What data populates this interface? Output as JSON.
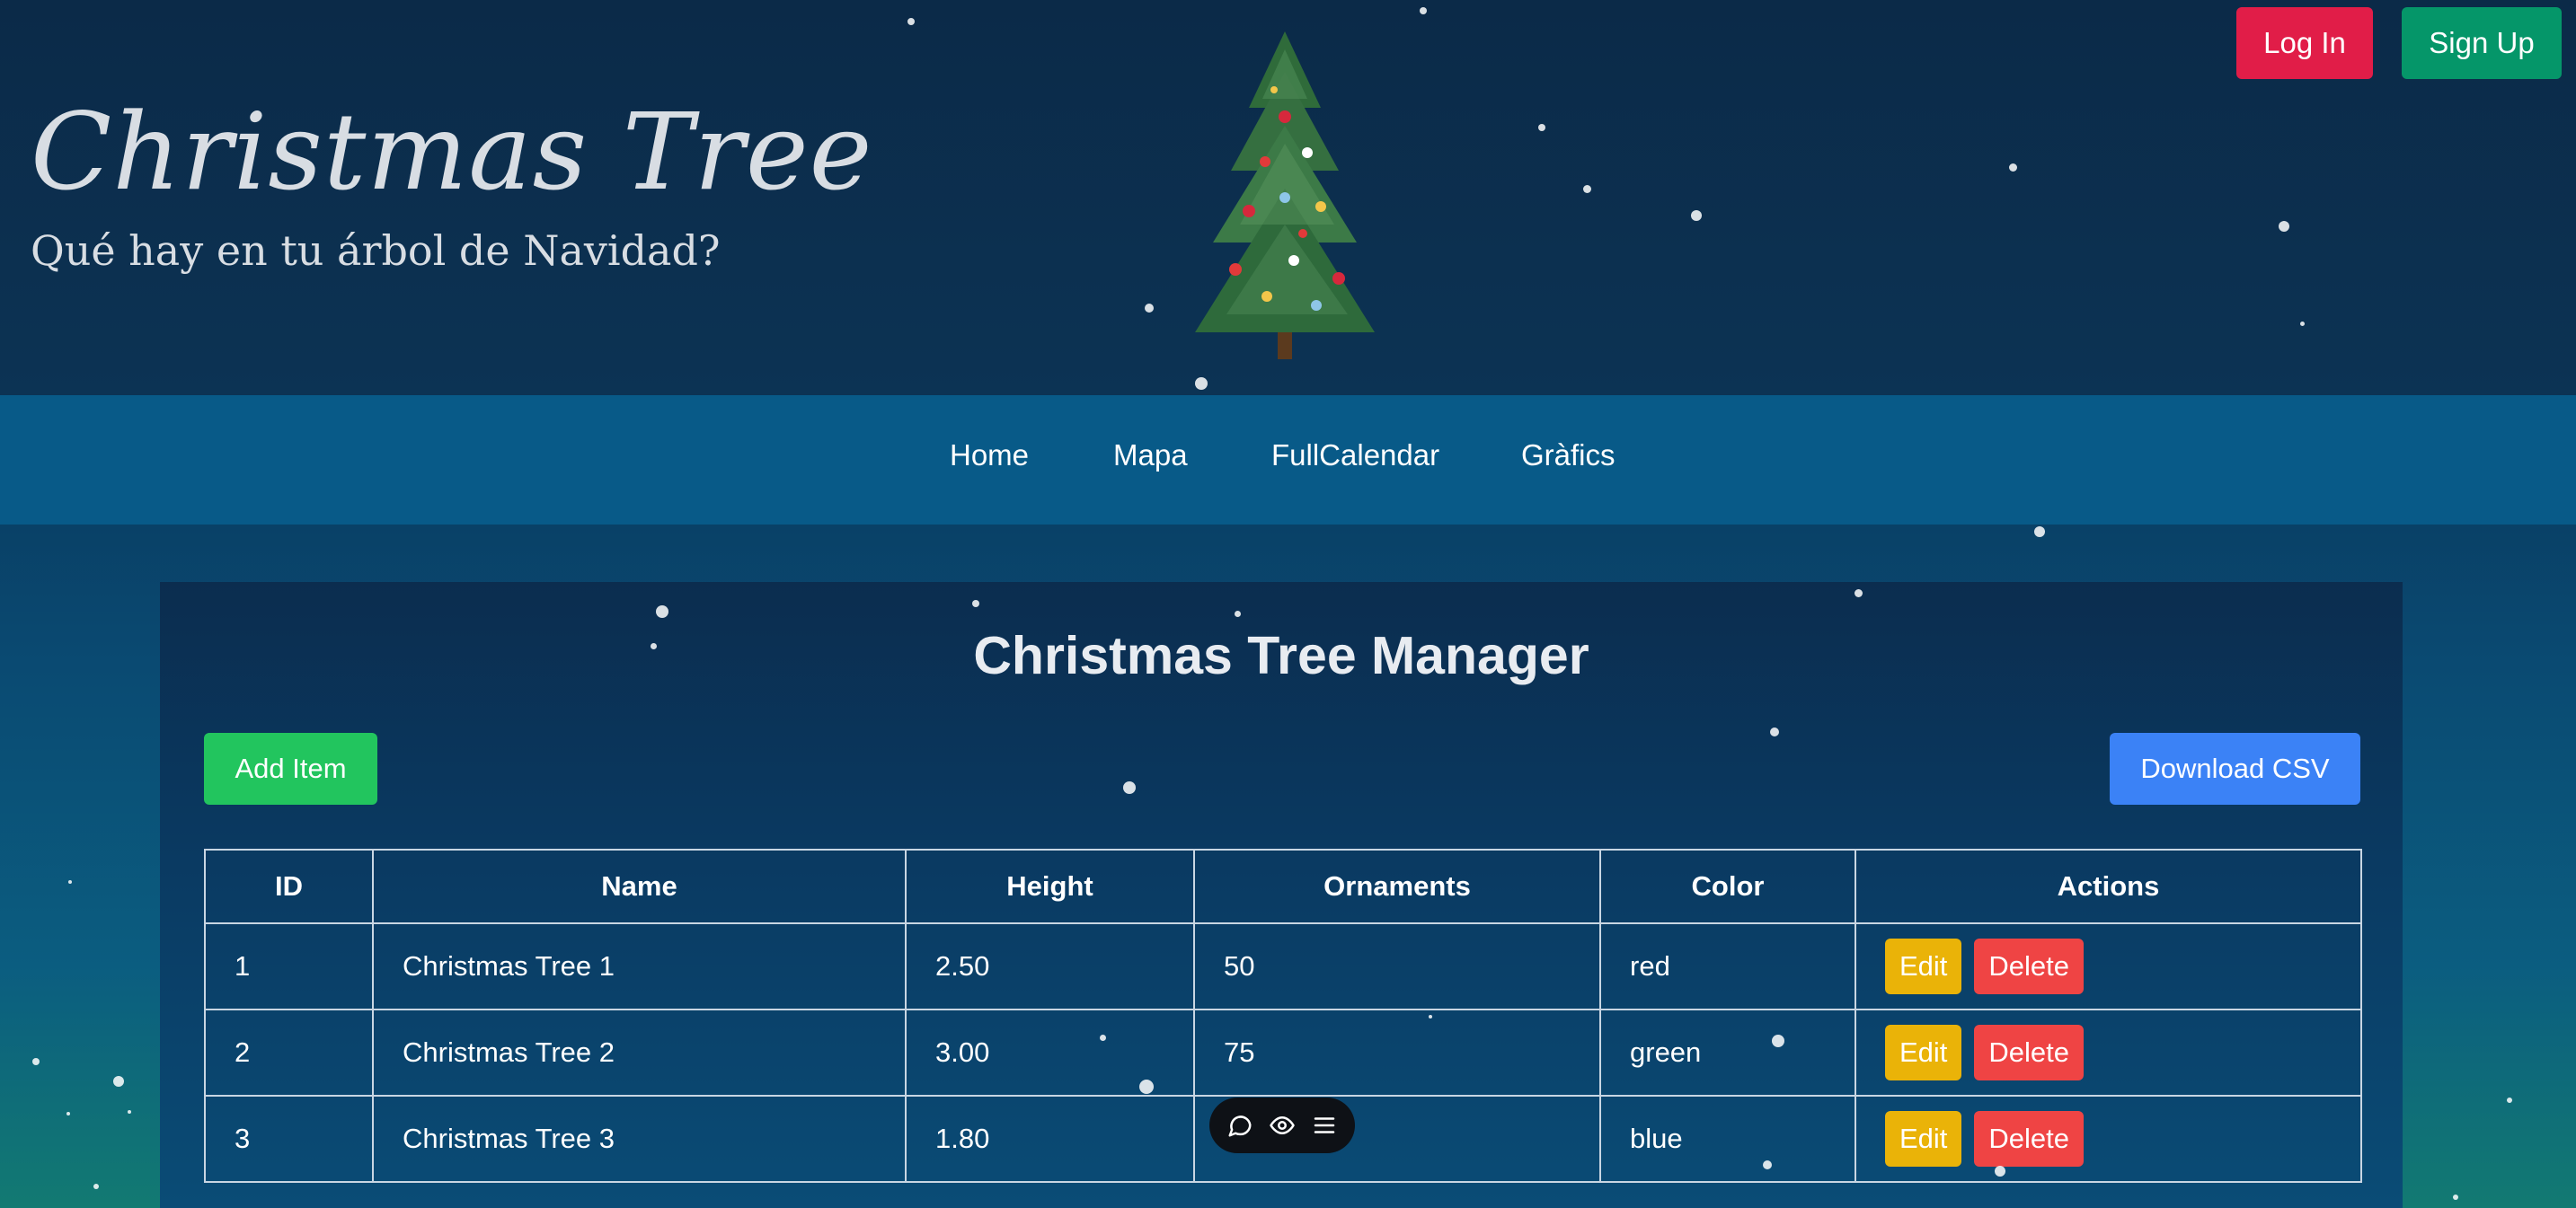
{
  "header": {
    "title": "Christmas Tree",
    "subtitle": "Qué hay en tu árbol de Navidad?",
    "logo_icon": "christmas-tree-icon"
  },
  "auth": {
    "login_label": "Log In",
    "signup_label": "Sign Up",
    "login_color": "#e11d48",
    "signup_color": "#059669"
  },
  "nav": {
    "items": [
      {
        "label": "Home"
      },
      {
        "label": "Mapa"
      },
      {
        "label": "FullCalendar"
      },
      {
        "label": "Gràfics"
      }
    ]
  },
  "main": {
    "title": "Christmas Tree Manager",
    "add_label": "Add Item",
    "download_label": "Download CSV",
    "table": {
      "columns": [
        "ID",
        "Name",
        "Height",
        "Ornaments",
        "Color",
        "Actions"
      ],
      "rows": [
        {
          "id": "1",
          "name": "Christmas Tree 1",
          "height": "2.50",
          "ornaments": "50",
          "color": "red"
        },
        {
          "id": "2",
          "name": "Christmas Tree 2",
          "height": "3.00",
          "ornaments": "75",
          "color": "green"
        },
        {
          "id": "3",
          "name": "Christmas Tree 3",
          "height": "1.80",
          "ornaments": "",
          "color": "blue"
        }
      ],
      "edit_label": "Edit",
      "delete_label": "Delete"
    }
  },
  "toolbar": {
    "icons": [
      "comment-icon",
      "eye-icon",
      "menu-icon"
    ]
  },
  "colors": {
    "add": "#22c55e",
    "download": "#3b82f6",
    "edit": "#eab308",
    "delete": "#ef4444",
    "nav_bg": "#085a88"
  }
}
